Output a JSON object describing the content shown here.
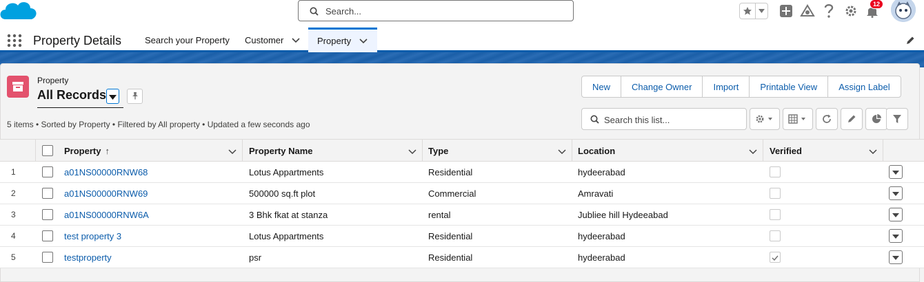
{
  "header": {
    "search_placeholder": "Search...",
    "notifications_count": "12"
  },
  "nav": {
    "app_name": "Property Details",
    "items": [
      {
        "label": "Search your Property"
      },
      {
        "label": "Customer"
      },
      {
        "label": "Property"
      }
    ]
  },
  "listview": {
    "object_label": "Property",
    "title": "All Records",
    "meta": "5 items • Sorted by Property • Filtered by All property • Updated a few seconds ago",
    "buttons": [
      "New",
      "Change Owner",
      "Import",
      "Printable View",
      "Assign Label"
    ],
    "search_placeholder": "Search this list..."
  },
  "table": {
    "columns": [
      "Property",
      "Property Name",
      "Type",
      "Location",
      "Verified"
    ],
    "sort_indicator": "↑",
    "rows": [
      {
        "num": "1",
        "property": "a01NS00000RNW68",
        "name": "Lotus Appartments",
        "type": "Residential",
        "location": "hydeerabad",
        "verified": false
      },
      {
        "num": "2",
        "property": "a01NS00000RNW69",
        "name": "500000 sq.ft plot",
        "type": "Commercial",
        "location": "Amravati",
        "verified": false
      },
      {
        "num": "3",
        "property": "a01NS00000RNW6A",
        "name": "3 Bhk fkat at stanza",
        "type": "rental",
        "location": "Jubliee hill Hydeeabad",
        "verified": false
      },
      {
        "num": "4",
        "property": "test property 3",
        "name": "Lotus Appartments",
        "type": "Residential",
        "location": "hydeerabad",
        "verified": false
      },
      {
        "num": "5",
        "property": "testproperty",
        "name": "psr",
        "type": "Residential",
        "location": "hydeerabad",
        "verified": true
      }
    ]
  },
  "colors": {
    "brand": "#0176d3",
    "link": "#0b5cab",
    "object_icon": "#e3526d"
  }
}
